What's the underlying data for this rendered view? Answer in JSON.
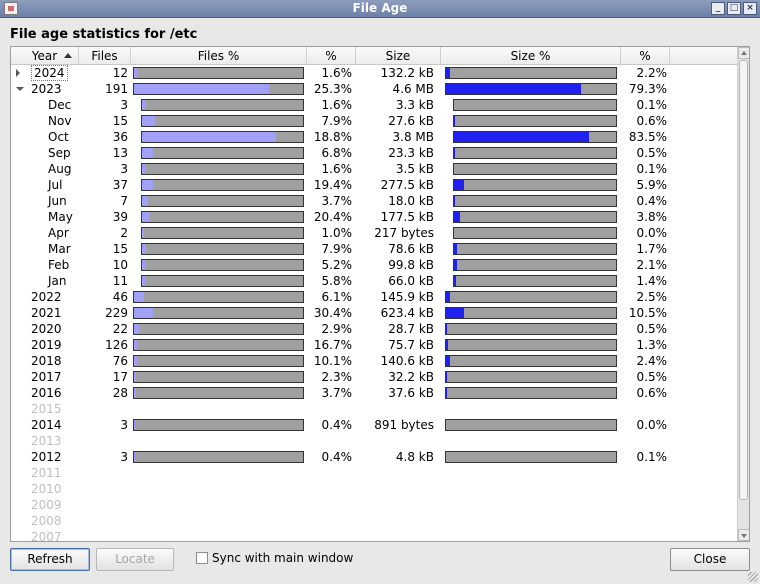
{
  "window": {
    "title": "File Age"
  },
  "heading": "File age statistics for /etc",
  "columns": {
    "year": "Year",
    "files": "Files",
    "files_pct": "Files %",
    "pct": "%",
    "size": "Size",
    "size_pct": "Size %",
    "pct2": "%"
  },
  "colors": {
    "files_fill": "#a0a0f6",
    "size_fill": "#2020f0",
    "bar_bg": "#a0a0a0"
  },
  "rows": [
    {
      "year": "2024",
      "files": "12",
      "files_frac": 0.016,
      "files_pct": "1.6%",
      "size": "132.2 kB",
      "size_frac": 0.022,
      "size_pct": "2.2%",
      "expander": "closed",
      "selected_outline": true
    },
    {
      "year": "2023",
      "files": "191",
      "files_frac": 0.797,
      "files_pct": "25.3%",
      "size": "4.6 MB",
      "size_frac": 0.793,
      "size_pct": "79.3%",
      "expander": "open"
    },
    {
      "year": "Dec",
      "files": "3",
      "files_frac": 0.016,
      "files_pct": "1.6%",
      "size": "3.3 kB",
      "size_frac": 0.001,
      "size_pct": "0.1%",
      "month": true
    },
    {
      "year": "Nov",
      "files": "15",
      "files_frac": 0.079,
      "files_pct": "7.9%",
      "size": "27.6 kB",
      "size_frac": 0.006,
      "size_pct": "0.6%",
      "month": true
    },
    {
      "year": "Oct",
      "files": "36",
      "files_frac": 0.83,
      "files_pct": "18.8%",
      "size": "3.8 MB",
      "size_frac": 0.835,
      "size_pct": "83.5%",
      "month": true
    },
    {
      "year": "Sep",
      "files": "13",
      "files_frac": 0.068,
      "files_pct": "6.8%",
      "size": "23.3 kB",
      "size_frac": 0.005,
      "size_pct": "0.5%",
      "month": true
    },
    {
      "year": "Aug",
      "files": "3",
      "files_frac": 0.016,
      "files_pct": "1.6%",
      "size": "3.5 kB",
      "size_frac": 0.001,
      "size_pct": "0.1%",
      "month": true
    },
    {
      "year": "Jul",
      "files": "37",
      "files_frac": 0.07,
      "files_pct": "19.4%",
      "size": "277.5 kB",
      "size_frac": 0.059,
      "size_pct": "5.9%",
      "month": true
    },
    {
      "year": "Jun",
      "files": "7",
      "files_frac": 0.037,
      "files_pct": "3.7%",
      "size": "18.0 kB",
      "size_frac": 0.004,
      "size_pct": "0.4%",
      "month": true
    },
    {
      "year": "May",
      "files": "39",
      "files_frac": 0.05,
      "files_pct": "20.4%",
      "size": "177.5 kB",
      "size_frac": 0.038,
      "size_pct": "3.8%",
      "month": true
    },
    {
      "year": "Apr",
      "files": "2",
      "files_frac": 0.01,
      "files_pct": "1.0%",
      "size": "217 bytes",
      "size_frac": 0.0,
      "size_pct": "0.0%",
      "month": true
    },
    {
      "year": "Mar",
      "files": "15",
      "files_frac": 0.025,
      "files_pct": "7.9%",
      "size": "78.6 kB",
      "size_frac": 0.017,
      "size_pct": "1.7%",
      "month": true
    },
    {
      "year": "Feb",
      "files": "10",
      "files_frac": 0.02,
      "files_pct": "5.2%",
      "size": "99.8 kB",
      "size_frac": 0.021,
      "size_pct": "2.1%",
      "month": true
    },
    {
      "year": "Jan",
      "files": "11",
      "files_frac": 0.02,
      "files_pct": "5.8%",
      "size": "66.0 kB",
      "size_frac": 0.014,
      "size_pct": "1.4%",
      "month": true
    },
    {
      "year": "2022",
      "files": "46",
      "files_frac": 0.061,
      "files_pct": "6.1%",
      "size": "145.9 kB",
      "size_frac": 0.025,
      "size_pct": "2.5%"
    },
    {
      "year": "2021",
      "files": "229",
      "files_frac": 0.115,
      "files_pct": "30.4%",
      "size": "623.4 kB",
      "size_frac": 0.105,
      "size_pct": "10.5%"
    },
    {
      "year": "2020",
      "files": "22",
      "files_frac": 0.029,
      "files_pct": "2.9%",
      "size": "28.7 kB",
      "size_frac": 0.005,
      "size_pct": "0.5%"
    },
    {
      "year": "2019",
      "files": "126",
      "files_frac": 0.02,
      "files_pct": "16.7%",
      "size": "75.7 kB",
      "size_frac": 0.013,
      "size_pct": "1.3%"
    },
    {
      "year": "2018",
      "files": "76",
      "files_frac": 0.015,
      "files_pct": "10.1%",
      "size": "140.6 kB",
      "size_frac": 0.024,
      "size_pct": "2.4%"
    },
    {
      "year": "2017",
      "files": "17",
      "files_frac": 0.01,
      "files_pct": "2.3%",
      "size": "32.2 kB",
      "size_frac": 0.005,
      "size_pct": "0.5%"
    },
    {
      "year": "2016",
      "files": "28",
      "files_frac": 0.012,
      "files_pct": "3.7%",
      "size": "37.6 kB",
      "size_frac": 0.006,
      "size_pct": "0.6%"
    },
    {
      "year": "2015",
      "empty": true
    },
    {
      "year": "2014",
      "files": "3",
      "files_frac": 0.004,
      "files_pct": "0.4%",
      "size": "891 bytes",
      "size_frac": 0.0,
      "size_pct": "0.0%"
    },
    {
      "year": "2013",
      "empty": true
    },
    {
      "year": "2012",
      "files": "3",
      "files_frac": 0.004,
      "files_pct": "0.4%",
      "size": "4.8 kB",
      "size_frac": 0.001,
      "size_pct": "0.1%"
    },
    {
      "year": "2011",
      "empty": true
    },
    {
      "year": "2010",
      "empty": true
    },
    {
      "year": "2009",
      "empty": true
    },
    {
      "year": "2008",
      "empty": true
    },
    {
      "year": "2007",
      "empty": true
    }
  ],
  "buttons": {
    "refresh": "Refresh",
    "locate": "Locate",
    "close": "Close"
  },
  "sync": {
    "label": "Sync with main window",
    "checked": false
  }
}
